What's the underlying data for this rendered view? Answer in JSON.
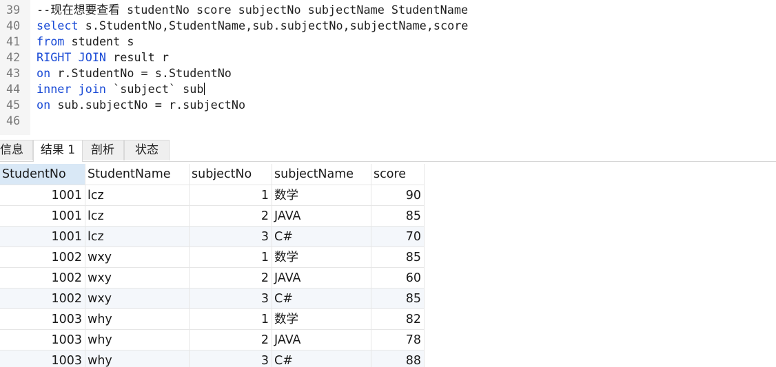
{
  "editor": {
    "lines": [
      {
        "num": "39",
        "parts": [
          {
            "t": "--现在想要查看 studentNo score subjectNo subjectName StudentName",
            "c": "cm"
          }
        ]
      },
      {
        "num": "40",
        "parts": [
          {
            "t": "select",
            "c": "kw"
          },
          {
            "t": " s.StudentNo,StudentName,sub.subjectNo,subjectName,score",
            "c": "tx"
          }
        ]
      },
      {
        "num": "41",
        "parts": [
          {
            "t": "from",
            "c": "kw"
          },
          {
            "t": " student s",
            "c": "tx"
          }
        ]
      },
      {
        "num": "42",
        "parts": [
          {
            "t": "RIGHT JOIN",
            "c": "kw"
          },
          {
            "t": " result r",
            "c": "tx"
          }
        ]
      },
      {
        "num": "43",
        "parts": [
          {
            "t": "on",
            "c": "kw"
          },
          {
            "t": " r.StudentNo = s.StudentNo",
            "c": "tx"
          }
        ]
      },
      {
        "num": "44",
        "parts": [
          {
            "t": "inner join",
            "c": "kw"
          },
          {
            "t": " `subject` sub",
            "c": "tx"
          }
        ],
        "caret": true
      },
      {
        "num": "45",
        "parts": [
          {
            "t": "on",
            "c": "kw"
          },
          {
            "t": " sub.subjectNo = r.subjectNo",
            "c": "tx"
          }
        ]
      },
      {
        "num": "46",
        "parts": []
      }
    ]
  },
  "tabs": [
    {
      "label": "信息",
      "active": false
    },
    {
      "label": "结果 1",
      "active": true
    },
    {
      "label": "剖析",
      "active": false
    },
    {
      "label": "状态",
      "active": false
    }
  ],
  "grid": {
    "columns": [
      "StudentNo",
      "StudentName",
      "subjectNo",
      "subjectName",
      "score"
    ],
    "selected_column": "StudentNo",
    "rows": [
      [
        "1001",
        "lcz",
        "1",
        "数学",
        "90"
      ],
      [
        "1001",
        "lcz",
        "2",
        "JAVA",
        "85"
      ],
      [
        "1001",
        "lcz",
        "3",
        "C#",
        "70"
      ],
      [
        "1002",
        "wxy",
        "1",
        "数学",
        "85"
      ],
      [
        "1002",
        "wxy",
        "2",
        "JAVA",
        "60"
      ],
      [
        "1002",
        "wxy",
        "3",
        "C#",
        "85"
      ],
      [
        "1003",
        "why",
        "1",
        "数学",
        "82"
      ],
      [
        "1003",
        "why",
        "2",
        "JAVA",
        "78"
      ],
      [
        "1003",
        "why",
        "3",
        "C#",
        "88"
      ]
    ]
  },
  "colors": {
    "keyword": "#1a4bd6",
    "selected_header": "#d9e8f6",
    "alt_row": "#f4f7fb"
  }
}
